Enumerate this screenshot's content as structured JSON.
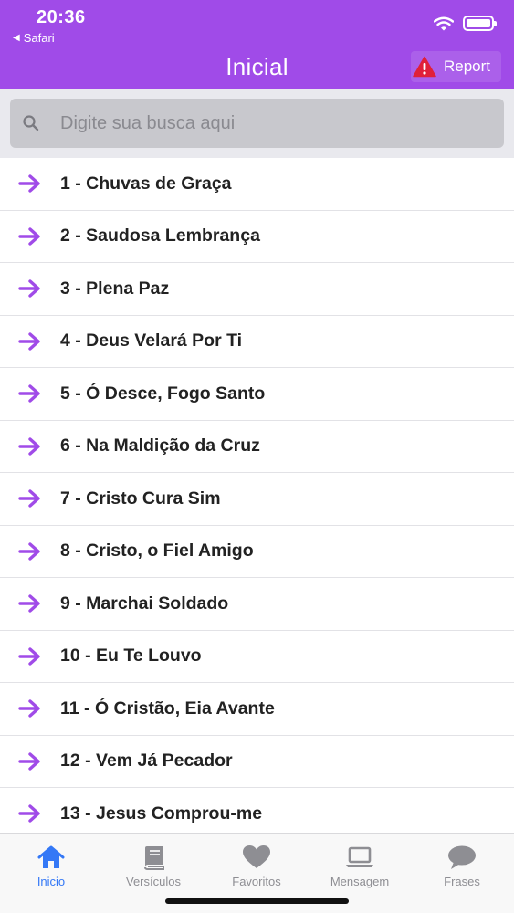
{
  "status_bar": {
    "time": "20:36",
    "back_app": "Safari"
  },
  "header": {
    "title": "Inicial",
    "report_label": "Report"
  },
  "search": {
    "placeholder": "Digite sua busca aqui"
  },
  "hymns": [
    {
      "label": "1 - Chuvas de Graça"
    },
    {
      "label": "2 - Saudosa Lembrança"
    },
    {
      "label": "3 - Plena Paz"
    },
    {
      "label": "4 - Deus Velará Por Ti"
    },
    {
      "label": "5 - Ó Desce, Fogo Santo"
    },
    {
      "label": "6 - Na Maldição da Cruz"
    },
    {
      "label": "7 - Cristo Cura Sim"
    },
    {
      "label": "8 - Cristo, o Fiel Amigo"
    },
    {
      "label": "9 - Marchai Soldado"
    },
    {
      "label": "10 - Eu Te Louvo"
    },
    {
      "label": "11 - Ó Cristão, Eia Avante"
    },
    {
      "label": "12 - Vem Já Pecador"
    },
    {
      "label": "13 - Jesus Comprou-me"
    }
  ],
  "tabs": [
    {
      "label": "Inicio",
      "icon": "home-icon",
      "active": true
    },
    {
      "label": "Versículos",
      "icon": "book-icon",
      "active": false
    },
    {
      "label": "Favoritos",
      "icon": "heart-icon",
      "active": false
    },
    {
      "label": "Mensagem",
      "icon": "laptop-icon",
      "active": false
    },
    {
      "label": "Frases",
      "icon": "chat-bubble-icon",
      "active": false
    }
  ],
  "colors": {
    "accent": "#a04be8",
    "active_tab": "#3478f6",
    "inactive_tab": "#8e8e93",
    "warning": "#e0203a"
  }
}
